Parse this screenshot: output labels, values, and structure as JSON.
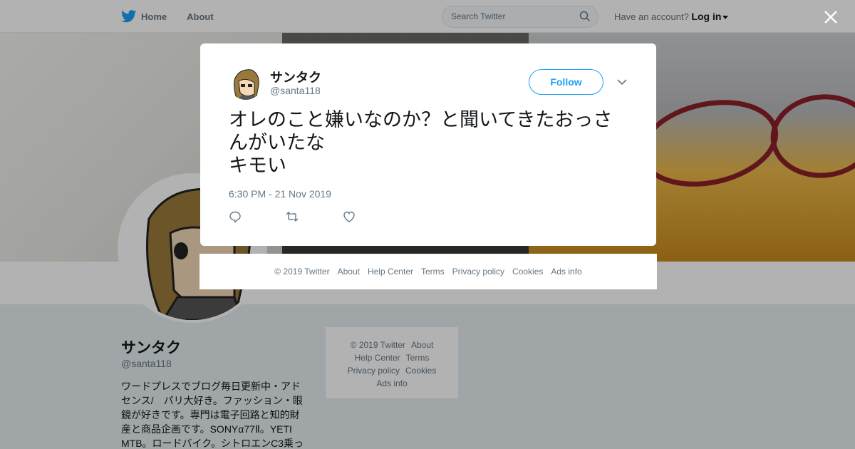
{
  "topbar": {
    "home_label": "Home",
    "about_label": "About",
    "search_placeholder": "Search Twitter",
    "account_prompt": "Have an account?",
    "login_label": "Log in"
  },
  "profile": {
    "name": "サンタク",
    "handle": "@santa118",
    "bio": "ワードプレスでブログ毎日更新中・アドセンス/　パリ大好き。ファッション・眼鏡が好きです。専門は電子回路と知的財産と商品企画です。SONYα77Ⅱ。YETI MTB。ロードバイク。シトロエンC3乗っ"
  },
  "side_footer": {
    "copyright": "© 2019 Twitter",
    "about": "About",
    "help": "Help Center",
    "terms": "Terms",
    "privacy": "Privacy policy",
    "cookies": "Cookies",
    "ads": "Ads info"
  },
  "tweet": {
    "author_name": "サンタク",
    "author_handle": "@santa118",
    "follow_label": "Follow",
    "text": "オレのこと嫌いなのか？と聞いてきたおっさんがいたな\nキモい",
    "timestamp": "6:30 PM - 21 Nov 2019"
  },
  "modal_footer": {
    "copyright": "© 2019 Twitter",
    "about": "About",
    "help": "Help Center",
    "terms": "Terms",
    "privacy": "Privacy policy",
    "cookies": "Cookies",
    "ads": "Ads info"
  },
  "colors": {
    "accent": "#1da1f2",
    "muted_text": "#657786"
  },
  "icons": [
    "twitter-bird-icon",
    "search-icon",
    "caret-down-icon",
    "close-icon",
    "chevron-down-icon",
    "reply-icon",
    "retweet-icon",
    "like-icon"
  ]
}
